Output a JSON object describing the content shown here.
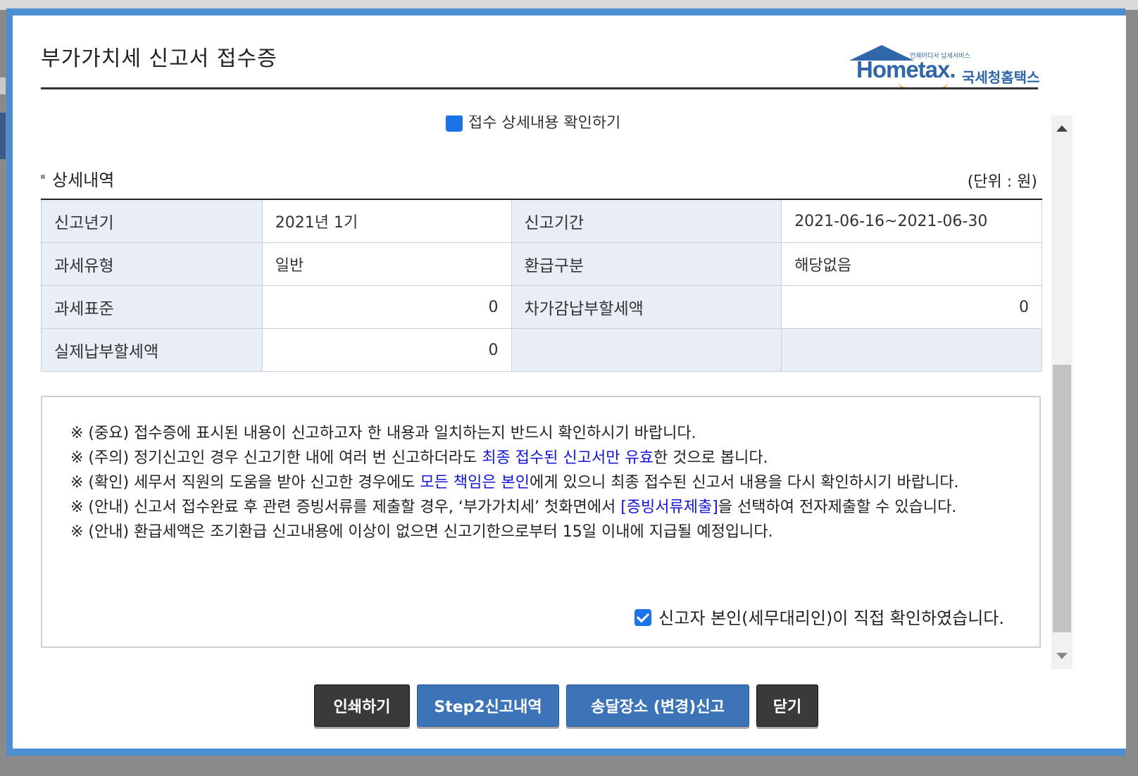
{
  "modal": {
    "title": "부가가치세 신고서 접수증",
    "logo": {
      "small_text": "언제어디서 납세서비스",
      "wordmark": "Hometax.",
      "korean": "국세청홈택스"
    }
  },
  "cutoff_row_text": "접수 상세내용 확인하기",
  "section": {
    "title": "상세내역",
    "unit": "(단위 : 원)"
  },
  "detail": {
    "rows": [
      {
        "label1": "신고년기",
        "value1": "2021년 1기",
        "label2": "신고기간",
        "value2": "2021-06-16~2021-06-30"
      },
      {
        "label1": "과세유형",
        "value1": "일반",
        "label2": "환급구분",
        "value2": "해당없음"
      },
      {
        "label1": "과세표준",
        "value1": "0",
        "label2": "차가감납부할세액",
        "value2": "0"
      },
      {
        "label1": "실제납부할세액",
        "value1": "0",
        "label2": "",
        "value2": ""
      }
    ]
  },
  "notice": {
    "line1": "※ (중요) 접수증에 표시된 내용이 신고하고자 한 내용과 일치하는지 반드시 확인하시기 바랍니다.",
    "line2_a": "※ (주의) 정기신고인 경우 신고기한 내에 여러 번 신고하더라도 ",
    "line2_hl": "최종 접수된 신고서만 유효",
    "line2_b": "한 것으로 봅니다.",
    "line3_a": "※ (확인) 세무서 직원의 도움을 받아 신고한 경우에도 ",
    "line3_hl": "모든 책임은 본인",
    "line3_b": "에게 있으니 최종 접수된 신고서 내용을 다시 확인하시기 바랍니다.",
    "line4_a": "※ (안내) 신고서 접수완료 후 관련 증빙서류를 제출할 경우, ‘부가가치세’ 첫화면에서 ",
    "line4_hl": "[증빙서류제출]",
    "line4_b": "을 선택하여 전자제출할 수 있습니다.",
    "line5": "※ (안내) 환급세액은 조기환급 신고내용에 이상이 없으면 신고기한으로부터 15일 이내에 지급될 예정입니다.",
    "confirm_label": "신고자 본인(세무대리인)이 직접 확인하였습니다."
  },
  "buttons": {
    "print": "인쇄하기",
    "step2": "Step2신고내역",
    "delivery": "송달장소 (변경)신고",
    "close": "닫기"
  },
  "colors": {
    "accent": "#3d74b8",
    "highlight": "#1515d9",
    "header_bg": "#e8edf6"
  }
}
